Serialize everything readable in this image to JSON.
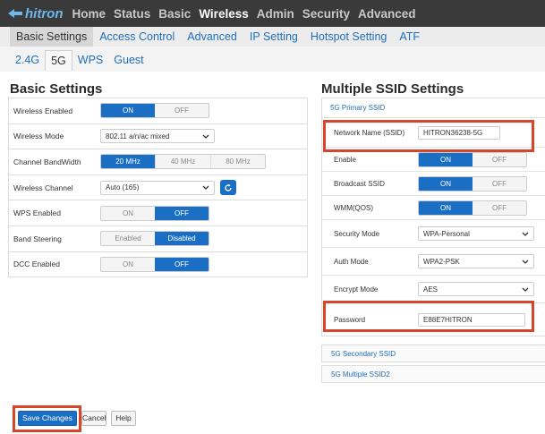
{
  "brand": {
    "logo_text": "hitron",
    "logo_color": "#6fb7e8"
  },
  "colors": {
    "accent": "#1a6fc4",
    "highlight": "#d9452b",
    "topbar": "#3a3a3a",
    "link": "#1f6fb8"
  },
  "top_nav": [
    "Home",
    "Status",
    "Basic",
    "Wireless",
    "Admin",
    "Security",
    "Advanced"
  ],
  "sub_nav": [
    "Basic Settings",
    "Access Control",
    "Advanced",
    "IP Setting",
    "Hotspot Setting",
    "ATF"
  ],
  "band_tabs": [
    "2.4G",
    "5G",
    "WPS",
    "Guest"
  ],
  "basic": {
    "title": "Basic Settings",
    "wireless_enabled": {
      "label": "Wireless Enabled",
      "on": "ON",
      "off": "OFF",
      "selected": "ON"
    },
    "wireless_mode": {
      "label": "Wireless Mode",
      "value": "802.11 a/n/ac mixed"
    },
    "channel_bandwidth": {
      "label": "Channel BandWidth",
      "options": [
        "20 MHz",
        "40 MHz",
        "80 MHz"
      ],
      "selected": "20 MHz"
    },
    "wireless_channel": {
      "label": "Wireless Channel",
      "value": "Auto (165)",
      "refresh_icon": "refresh-icon"
    },
    "wps_enabled": {
      "label": "WPS Enabled",
      "on": "ON",
      "off": "OFF",
      "selected": "OFF"
    },
    "band_steering": {
      "label": "Band Steering",
      "enabled": "Enabled",
      "disabled": "Disabled",
      "selected": "Disabled"
    },
    "dcc_enabled": {
      "label": "DCC Enabled",
      "on": "ON",
      "off": "OFF",
      "selected": "OFF"
    }
  },
  "ssid": {
    "title": "Multiple SSID Settings",
    "primary_head": "5G Primary SSID",
    "network_name": {
      "label": "Network Name (SSID)",
      "value": "HITRON36238-5G"
    },
    "enable": {
      "label": "Enable",
      "on": "ON",
      "off": "OFF",
      "selected": "ON"
    },
    "broadcast": {
      "label": "Broadcast SSID",
      "on": "ON",
      "off": "OFF",
      "selected": "ON"
    },
    "wmm": {
      "label": "WMM(QOS)",
      "on": "ON",
      "off": "OFF",
      "selected": "ON"
    },
    "security_mode": {
      "label": "Security Mode",
      "value": "WPA-Personal"
    },
    "auth_mode": {
      "label": "Auth Mode",
      "value": "WPA2-PSK"
    },
    "encrypt_mode": {
      "label": "Encrypt Mode",
      "value": "AES"
    },
    "password": {
      "label": "Password",
      "value": "E88E7HITRON"
    },
    "secondary_head": "5G Secondary SSID",
    "multiple2_head": "5G Multiple SSID2"
  },
  "actions": {
    "save": "Save Changes",
    "cancel": "Cancel",
    "help": "Help"
  }
}
